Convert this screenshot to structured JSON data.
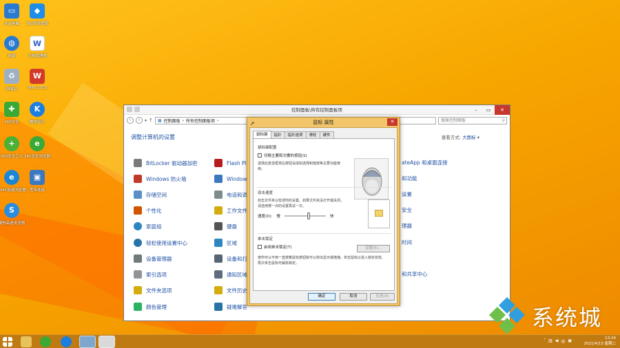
{
  "desktop_icons": [
    {
      "label": "这台电脑",
      "glyph": "🖥",
      "color": "#2a7bd0"
    },
    {
      "label": "360软件管家",
      "glyph": "◆",
      "color": "#1f8ee8"
    },
    {
      "label": "网络",
      "glyph": "🌐",
      "color": "#2a7bd0"
    },
    {
      "label": "文档管理器",
      "glyph": "W",
      "color": "#2b5fbf"
    },
    {
      "label": "回收站",
      "glyph": "🗑",
      "color": "#8aa0b8"
    },
    {
      "label": "WPS 2019",
      "glyph": "W",
      "color": "#d43a2a"
    },
    {
      "label": "360安全",
      "glyph": "✚",
      "color": "#3aa935"
    },
    {
      "label": "酷狗音乐",
      "glyph": "K",
      "color": "#1a7fe0"
    },
    {
      "label": "360安全卫士",
      "glyph": "+",
      "color": "#4cb035"
    },
    {
      "label": "360安全浏览器",
      "glyph": "e",
      "color": "#3aa935"
    },
    {
      "label": "2345加速浏览器",
      "glyph": "e",
      "color": "#1a87d6"
    },
    {
      "label": "宽带连接",
      "glyph": "🖧",
      "color": "#3a78c0"
    },
    {
      "label": "搜狗高速浏览器",
      "glyph": "S",
      "color": "#2a8ee0"
    }
  ],
  "control_panel": {
    "title": "控制面板\\所有控制面板项",
    "breadcrumb": [
      "控制面板",
      "所有控制面板项"
    ],
    "search_placeholder": "搜索控制面板",
    "heading": "调整计算机的设置",
    "view_by_label": "查看方式:",
    "view_by_value": "大图标",
    "items_col1": [
      {
        "label": "BitLocker 驱动器加密",
        "color": "#7a7a7a"
      },
      {
        "label": "Windows 防火墙",
        "color": "#c0392b"
      },
      {
        "label": "存储空间",
        "color": "#5a8fc8"
      },
      {
        "label": "个性化",
        "color": "#d35400"
      },
      {
        "label": "家庭组",
        "color": "#2e86c1"
      },
      {
        "label": "轻松使用设置中心",
        "color": "#2874a6"
      },
      {
        "label": "设备管理器",
        "color": "#707b7c"
      },
      {
        "label": "索引选项",
        "color": "#909497"
      },
      {
        "label": "文件夹选项",
        "color": "#d4ac0d"
      },
      {
        "label": "颜色管理",
        "color": "#28b463"
      }
    ],
    "items_col2": [
      {
        "label": "Flash Pla",
        "color": "#b71c1c"
      },
      {
        "label": "Window",
        "color": "#3a78c0"
      },
      {
        "label": "电话和调",
        "color": "#7f8c8d"
      },
      {
        "label": "工作文件",
        "color": "#d4ac0d"
      },
      {
        "label": "键盘",
        "color": "#555555"
      },
      {
        "label": "区域",
        "color": "#2e86c1"
      },
      {
        "label": "设备和打",
        "color": "#566573"
      },
      {
        "label": "通知区域",
        "color": "#5d6d7e"
      },
      {
        "label": "文件历史",
        "color": "#d4ac0d"
      },
      {
        "label": "疑难解答",
        "color": "#2874a6"
      }
    ],
    "items_col3": [
      {
        "label": "ateApp 和桌面连接"
      },
      {
        "label": "和功能"
      },
      {
        "label": "设置"
      },
      {
        "label": "安全"
      },
      {
        "label": "理器"
      },
      {
        "label": "时间"
      },
      {
        "label": ""
      },
      {
        "label": "和共享中心"
      },
      {
        "label": ""
      },
      {
        "label": ""
      }
    ]
  },
  "dialog": {
    "title": "鼠标 属性",
    "tabs": [
      "鼠标键",
      "指针",
      "指针选项",
      "滑轮",
      "硬件"
    ],
    "group1_title": "鼠标键配置",
    "switch_buttons_label": "切换主要和次要的按钮(S)",
    "switch_desc": "选择此复选框将右按钮设成如选择和拖放等主要功能使用。",
    "group2_title": "双击速度",
    "dblclick_desc": "双击文件夹以检测你的设置。如果文件夹没打开或关闭，请选用慢一点的设置再试一次。",
    "speed_label": "速度(D):",
    "slow_label": "慢",
    "fast_label": "快",
    "group3_title": "单击锁定",
    "clicklock_label": "启用单击锁定(T)",
    "settings_button": "设置(E)...",
    "clicklock_desc": "使你可以不用一直按着鼠标按钮就可以突出显示或拖拽。单击鼠标以进入锁定状态,再次单击鼠标可解除锁定。",
    "ok_label": "确定",
    "cancel_label": "取消",
    "apply_label": "应用(A)"
  },
  "taskbar": {
    "time": "13:24",
    "date": "2021/4/13 星期二",
    "ime": "中"
  },
  "watermark": {
    "text": "系统城"
  }
}
